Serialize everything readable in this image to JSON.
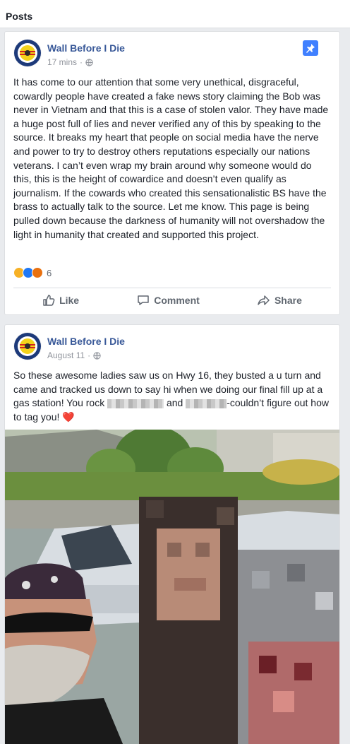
{
  "section": {
    "title": "Posts"
  },
  "posts": [
    {
      "author": "Wall Before I Die",
      "time": "17 mins",
      "separator": "·",
      "text": "It has come to our attention that some very unethical, disgraceful, cowardly people have created a fake news story claiming the Bob was never in Vietnam and that this is a case of stolen valor. They have made a huge post full of lies and never verified any of this by speaking to the source. It breaks my heart that people on social media have the nerve and power to try to destroy others reputations especially our nations veterans. I can’t even wrap my brain around why someone would do this, this is the height of cowardice and doesn’t even qualify as journalism. If the cowards who created this sensationalistic BS have the brass to actually talk to the source. Let me know. This page is being pulled down because the darkness of humanity will not overshadow the light in humanity that created and supported this project.",
      "reaction_count": "6",
      "reaction_icons": [
        "sad-icon",
        "like-icon",
        "angry-icon"
      ],
      "actions": {
        "like": "Like",
        "comment": "Comment",
        "share": "Share"
      }
    },
    {
      "author": "Wall Before I Die",
      "time": "August 11",
      "separator": "·",
      "text_part1": "So these awesome ladies saw us on Hwy 16, they busted a u turn and came and tracked us down to say hi when we doing our final fill up at a gas station! You rock",
      "text_part2": "and",
      "text_part3": "-couldn’t figure out how to tag you!",
      "heart": "❤️"
    }
  ],
  "colors": {
    "link": "#385898",
    "pin": "#4080ff",
    "like": "#2078f4",
    "sad": "#f7b125",
    "angry": "#e9710f",
    "heart": "#e41e3f"
  }
}
